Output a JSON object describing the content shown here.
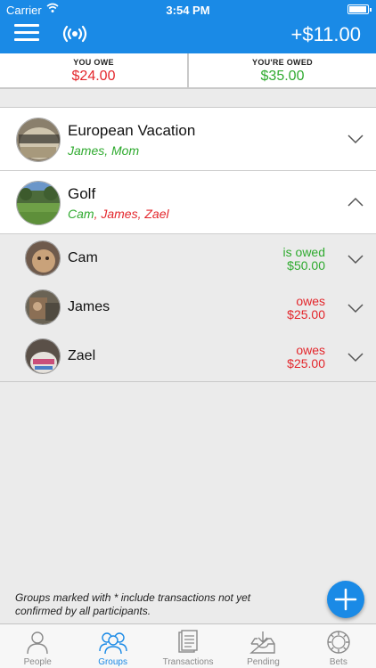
{
  "status_bar": {
    "carrier": "Carrier",
    "time": "3:54 PM"
  },
  "header": {
    "balance": "+$11.00"
  },
  "summary": {
    "you_owe_label": "YOU OWE",
    "you_owe_amount": "$24.00",
    "youre_owed_label": "YOU'RE OWED",
    "youre_owed_amount": "$35.00"
  },
  "groups": [
    {
      "name": "European Vacation",
      "members": "James, Mom",
      "expanded": false
    },
    {
      "name": "Golf",
      "members": "Cam, James, Zael",
      "expanded": true,
      "participants": [
        {
          "name": "Cam",
          "status": "is owed",
          "amount": "$50.00",
          "color": "#2faa2f"
        },
        {
          "name": "James",
          "status": "owes",
          "amount": "$25.00",
          "color": "#e3262b"
        },
        {
          "name": "Zael",
          "status": "owes",
          "amount": "$25.00",
          "color": "#e3262b"
        }
      ]
    }
  ],
  "footer_note": "Groups marked with * include transactions not yet confirmed by all participants.",
  "tabs": [
    {
      "label": "People",
      "icon": "person-icon",
      "active": false
    },
    {
      "label": "Groups",
      "icon": "group-icon",
      "active": true
    },
    {
      "label": "Transactions",
      "icon": "document-icon",
      "active": false
    },
    {
      "label": "Pending",
      "icon": "inbox-icon",
      "active": false
    },
    {
      "label": "Bets",
      "icon": "chip-icon",
      "active": false
    }
  ],
  "colors": {
    "primary": "#1a8ae6",
    "owe": "#e3262b",
    "owed": "#2faa2f"
  }
}
